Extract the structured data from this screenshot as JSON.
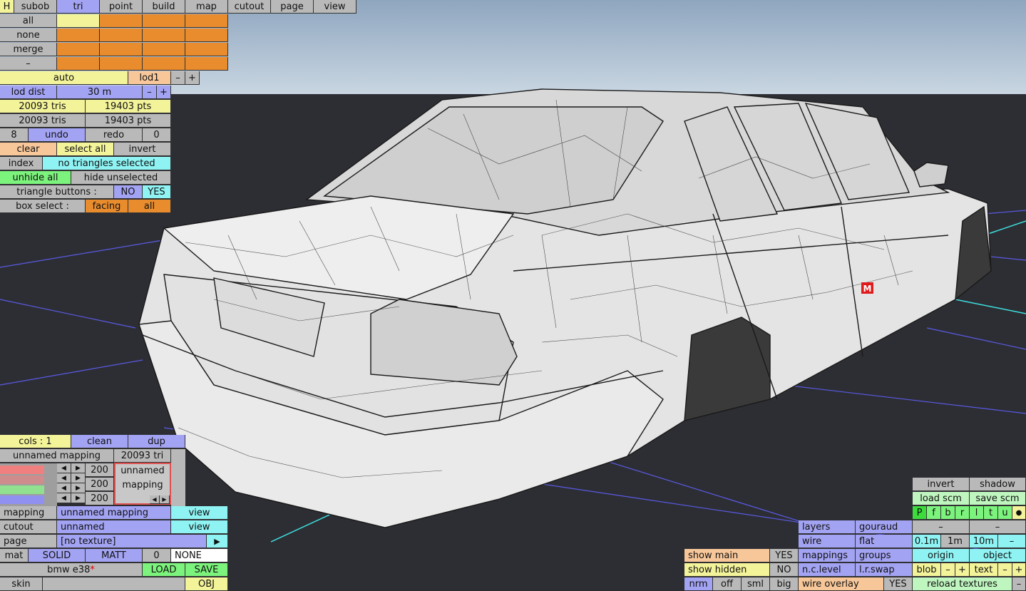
{
  "top_menu": {
    "h": "H",
    "tabs": [
      "subob",
      "tri",
      "point",
      "build",
      "map",
      "cutout",
      "page",
      "view"
    ]
  },
  "select_rows": {
    "all": "all",
    "none": "none",
    "merge": "merge",
    "minus": "–"
  },
  "lod": {
    "auto": "auto",
    "lod1": "lod1",
    "minus": "–",
    "plus": "+",
    "dist_label": "lod dist",
    "dist_value": "30 m"
  },
  "stats": {
    "tris1": "20093 tris",
    "pts1": "19403 pts",
    "tris2": "20093 tris",
    "pts2": "19403 pts"
  },
  "history": {
    "undo_count": "8",
    "undo": "undo",
    "redo": "redo",
    "redo_count": "0"
  },
  "selection": {
    "clear": "clear",
    "select_all": "select all",
    "invert": "invert",
    "index": "index",
    "status": "no triangles selected",
    "unhide_all": "unhide all",
    "hide_unselected": "hide unselected",
    "triangle_buttons_label": "triangle buttons :",
    "no": "NO",
    "yes": "YES",
    "box_select_label": "box select :",
    "facing": "facing",
    "all": "all"
  },
  "mapping_panel": {
    "cols": "cols : 1",
    "clean": "clean",
    "dup": "dup",
    "mapping_name": "unnamed mapping",
    "tri_count": "20093 tri",
    "r_value": "200",
    "g_value": "200",
    "b_value": "200",
    "preview_line1": "unnamed",
    "preview_line2": "mapping",
    "colors": {
      "r": "#f08080",
      "g": "#90e090",
      "b": "#9090f0"
    }
  },
  "properties": {
    "mapping_label": "mapping",
    "mapping_value": "unnamed mapping",
    "mapping_view": "view",
    "cutout_label": "cutout",
    "cutout_value": "unnamed",
    "cutout_view": "view",
    "page_label": "page",
    "page_value": "[no texture]",
    "page_arrow": "▶",
    "mat_label": "mat",
    "solid": "SOLID",
    "matt": "MATT",
    "mat_num": "0",
    "none": "NONE",
    "file_name": "bmw e38",
    "modified_mark": "*",
    "load": "LOAD",
    "save": "SAVE",
    "skin": "skin",
    "obj": "OBJ"
  },
  "view_panel": {
    "show_main": "show main",
    "show_main_val": "YES",
    "show_hidden": "show hidden",
    "show_hidden_val": "NO",
    "nrm": "nrm",
    "off": "off",
    "sml": "sml",
    "big": "big",
    "layers": "layers",
    "gouraud": "gouraud",
    "wire": "wire",
    "flat": "flat",
    "mappings": "mappings",
    "groups": "groups",
    "nc_level": "n.c.level",
    "lr_swap": "l.r.swap",
    "wire_overlay": "wire overlay",
    "wire_overlay_val": "YES"
  },
  "right_panel": {
    "invert": "invert",
    "shadow": "shadow",
    "load_scm": "load scm",
    "save_scm": "save scm",
    "letters": [
      "P",
      "f",
      "b",
      "r",
      "l",
      "t",
      "u"
    ],
    "dot": "●",
    "minus1": "–",
    "minus2": "–",
    "s01": "0.1m",
    "s1": "1m",
    "s10": "10m",
    "sminus": "–",
    "origin": "origin",
    "object": "object",
    "blob": "blob",
    "text": "text",
    "minus": "–",
    "plus": "+",
    "reload": "reload textures",
    "end_minus": "–"
  },
  "marker": "M"
}
